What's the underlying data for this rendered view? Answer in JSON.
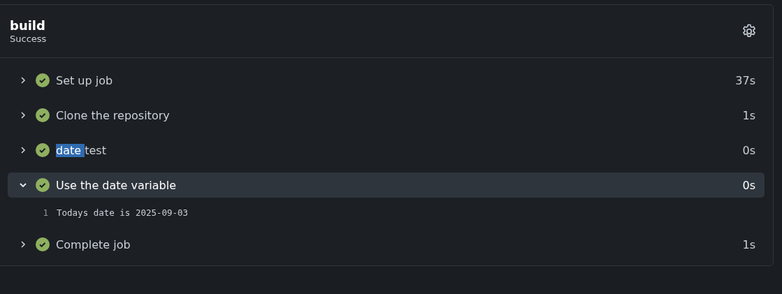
{
  "job": {
    "title": "build",
    "status": "Success"
  },
  "steps": [
    {
      "name": "Set up job",
      "duration": "37s",
      "expanded": false,
      "kind": "passed"
    },
    {
      "name": "Clone the repository",
      "duration": "1s",
      "expanded": false,
      "kind": "passed"
    },
    {
      "selected_text": "date ",
      "name": "test",
      "duration": "0s",
      "expanded": false,
      "kind": "passed"
    },
    {
      "name": "Use the date variable",
      "duration": "0s",
      "expanded": true,
      "kind": "passed",
      "log": [
        {
          "line_number": "1",
          "text": "Todays date is 2025-09-03"
        }
      ]
    },
    {
      "name": "Complete job",
      "duration": "1s",
      "expanded": false,
      "kind": "passed"
    }
  ]
}
